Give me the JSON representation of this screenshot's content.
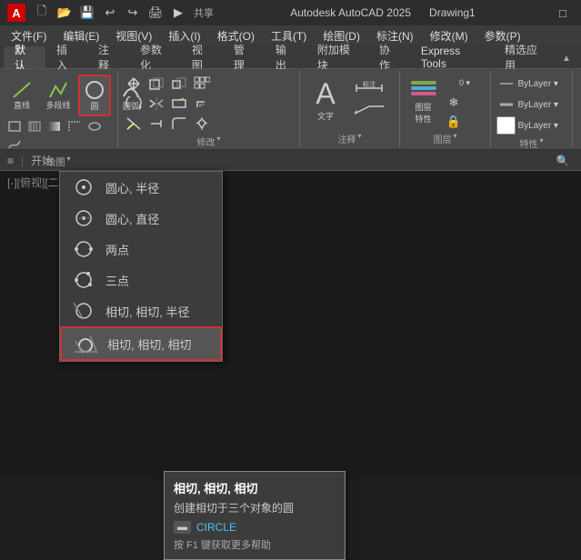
{
  "titleBar": {
    "appName": "A",
    "quickAccessIcons": [
      "new",
      "open",
      "save",
      "undo",
      "redo"
    ],
    "shareLabel": "共享",
    "appTitle": "Autodesk AutoCAD 2025",
    "drawingName": "Drawing1"
  },
  "menuBar": {
    "items": [
      {
        "id": "file",
        "label": "文件(F)"
      },
      {
        "id": "edit",
        "label": "编辑(E)"
      },
      {
        "id": "view",
        "label": "视图(V)"
      },
      {
        "id": "insert",
        "label": "插入(I)"
      },
      {
        "id": "format",
        "label": "格式(O)"
      },
      {
        "id": "tools",
        "label": "工具(T)"
      },
      {
        "id": "draw",
        "label": "绘图(D)"
      },
      {
        "id": "dim",
        "label": "标注(N)"
      },
      {
        "id": "modify",
        "label": "修改(M)"
      },
      {
        "id": "params",
        "label": "参数(P)"
      }
    ]
  },
  "ribbonTabs": {
    "tabs": [
      {
        "id": "default",
        "label": "默认",
        "active": true
      },
      {
        "id": "insert",
        "label": "插入"
      },
      {
        "id": "annotate",
        "label": "注释"
      },
      {
        "id": "parameterize",
        "label": "参数化"
      },
      {
        "id": "view",
        "label": "视图"
      },
      {
        "id": "manage",
        "label": "管理"
      },
      {
        "id": "output",
        "label": "输出"
      },
      {
        "id": "addon",
        "label": "附加模块"
      },
      {
        "id": "collaborate",
        "label": "协作"
      },
      {
        "id": "expresstools",
        "label": "Express Tools"
      },
      {
        "id": "fineapp",
        "label": "精选应用"
      }
    ]
  },
  "ribbonSections": {
    "draw": {
      "label": "绘图",
      "tools": [
        "直线",
        "多段线",
        "圆",
        "圆弧"
      ]
    },
    "modify": {
      "label": "修改",
      "dropdown": "▾"
    },
    "annotate": {
      "label": "注释",
      "dropdown": "▾"
    },
    "layers": {
      "label": "图层"
    }
  },
  "dropdownMenu": {
    "items": [
      {
        "id": "center-radius",
        "label": "圆心, 半径",
        "icon": "circle-dot"
      },
      {
        "id": "center-diameter",
        "label": "圆心, 直径",
        "icon": "circle-dot"
      },
      {
        "id": "two-points",
        "label": "两点",
        "icon": "circle-empty"
      },
      {
        "id": "three-points",
        "label": "三点",
        "icon": "circle-empty"
      },
      {
        "id": "tan-tan-radius",
        "label": "相切, 相切, 半径",
        "icon": "circle-slash"
      },
      {
        "id": "tan-tan-tan",
        "label": "相切, 相切, 相切",
        "icon": "circle-outline",
        "active": true
      }
    ]
  },
  "tooltip": {
    "title": "相切, 相切, 相切",
    "description": "创建相切于三个对象的圆",
    "command": "CIRCLE",
    "cmdIconLabel": "▬",
    "helpText": "按 F1 键获取更多帮助"
  },
  "statusBar": {
    "breadcrumbs": [
      "≡",
      "开始",
      "/"
    ]
  },
  "canvasLabel": "[-][俯视][二维"
}
